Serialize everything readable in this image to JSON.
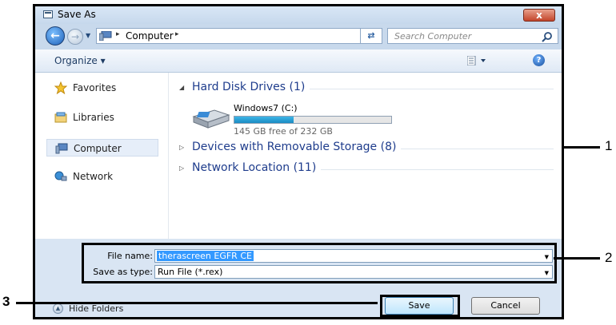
{
  "dialog": {
    "title": "Save As",
    "close_label": "x"
  },
  "address": {
    "path": "Computer",
    "sep": "▸",
    "search_placeholder": "Search Computer"
  },
  "toolbar": {
    "organize_label": "Organize ▾",
    "help_label": "?"
  },
  "nav_pane": {
    "items": [
      {
        "label": "Favorites",
        "icon": "star-icon"
      },
      {
        "label": "Libraries",
        "icon": "libraries-icon"
      },
      {
        "label": "Computer",
        "icon": "computer-icon",
        "selected": true
      },
      {
        "label": "Network",
        "icon": "network-icon"
      }
    ]
  },
  "content": {
    "groups": [
      {
        "label": "Hard Disk Drives (1)",
        "expanded": true
      },
      {
        "label": "Devices with Removable Storage (8)",
        "expanded": false
      },
      {
        "label": "Network Location (11)",
        "expanded": false
      }
    ],
    "drive": {
      "name": "Windows7 (C:)",
      "free_text": "145 GB free of 232 GB",
      "used_fraction": 0.375
    }
  },
  "form": {
    "file_name_label": "File name:",
    "file_name_value": "therascreen EGFR CE",
    "save_type_label": "Save as type:",
    "save_type_value": "Run File (*.rex)"
  },
  "footer": {
    "hide_folders_label": "Hide Folders",
    "save_label": "Save",
    "cancel_label": "Cancel"
  },
  "callouts": [
    "1",
    "2",
    "3"
  ],
  "colors": {
    "accent": "#3399ff",
    "frame": "#c8d9ec",
    "link_blue": "#1e3c8c"
  }
}
